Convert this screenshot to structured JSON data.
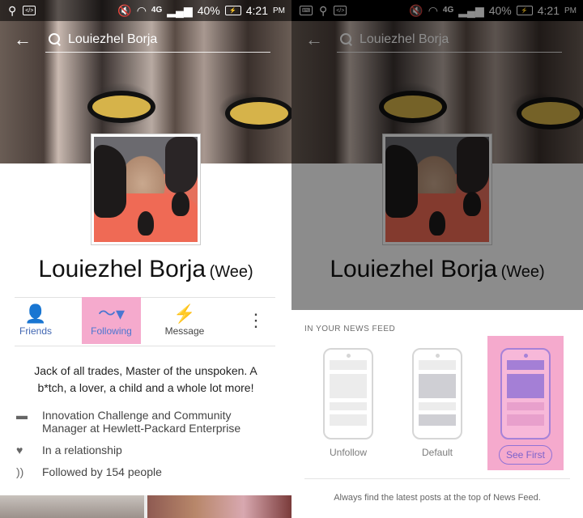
{
  "status_bar": {
    "battery": "40%",
    "time": "4:21",
    "ampm": "PM"
  },
  "search": {
    "query": "Louiezhel Borja"
  },
  "profile": {
    "name": "Louiezhel Borja",
    "nickname": "(Wee)",
    "bio": "Jack of all trades, Master of the unspoken. A b*tch, a lover, a child and a whole lot more!",
    "work": "Innovation Challenge and Community Manager at Hewlett-Packard Enterprise",
    "relationship": "In a relationship",
    "followers": "Followed by 154 people"
  },
  "actions": {
    "friends": "Friends",
    "following": "Following",
    "message": "Message"
  },
  "news_feed_sheet": {
    "title": "IN YOUR NEWS FEED",
    "options": [
      "Unfollow",
      "Default",
      "See First"
    ],
    "note": "Always find the latest posts at the top of News Feed."
  },
  "colors": {
    "accent_blue": "#4267b2",
    "highlight_pink": "#f5aacd",
    "see_first_purple": "#8f72d6"
  }
}
